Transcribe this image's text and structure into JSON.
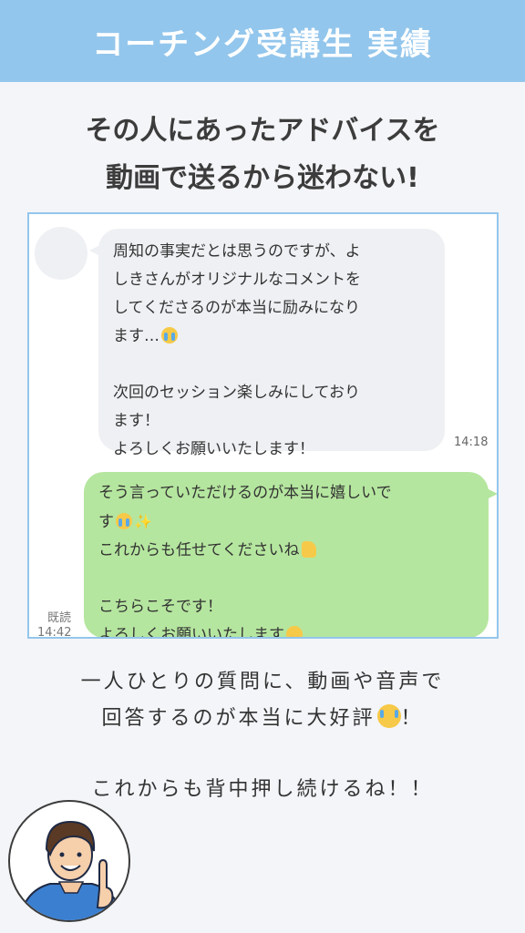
{
  "header": {
    "title": "コーチング受講生 実績"
  },
  "headline": {
    "line1": "その人にあったアドバイスを",
    "line2": "動画で送るから迷わない!"
  },
  "chat": {
    "incoming": {
      "lines": [
        "周知の事実だとは思うのですが、よ",
        "しきさんがオリジナルなコメントを",
        "してくださるのが本当に励みになり",
        "ます…",
        "",
        "次回のセッション楽しみにしており",
        "ます！",
        "よろしくお願いいたします！"
      ],
      "time": "14:18"
    },
    "outgoing": {
      "lines": [
        "そう言っていただけるのが本当に嬉しいで",
        "す",
        "これからも任せてくださいね",
        "",
        "こちらこそです！",
        "よろしくお願いいたします"
      ],
      "read_label": "既読",
      "time": "14:42"
    }
  },
  "message": {
    "line1": "一人ひとりの質問に、動画や音声で",
    "line2": "回答するのが本当に大好評",
    "line2_suffix": "！",
    "line3": "これからも背中押し続けるね！！"
  },
  "icons": {
    "crying": "loudly-crying-face-icon",
    "sparkles": "sparkles-icon",
    "thumbs_up": "thumbs-up-icon",
    "smiling": "smiling-face-icon"
  },
  "colors": {
    "header": "#93c6ec",
    "incoming_bubble": "#eef0f3",
    "outgoing_bubble": "#b5e69f",
    "frame_border": "#93c6ec"
  }
}
